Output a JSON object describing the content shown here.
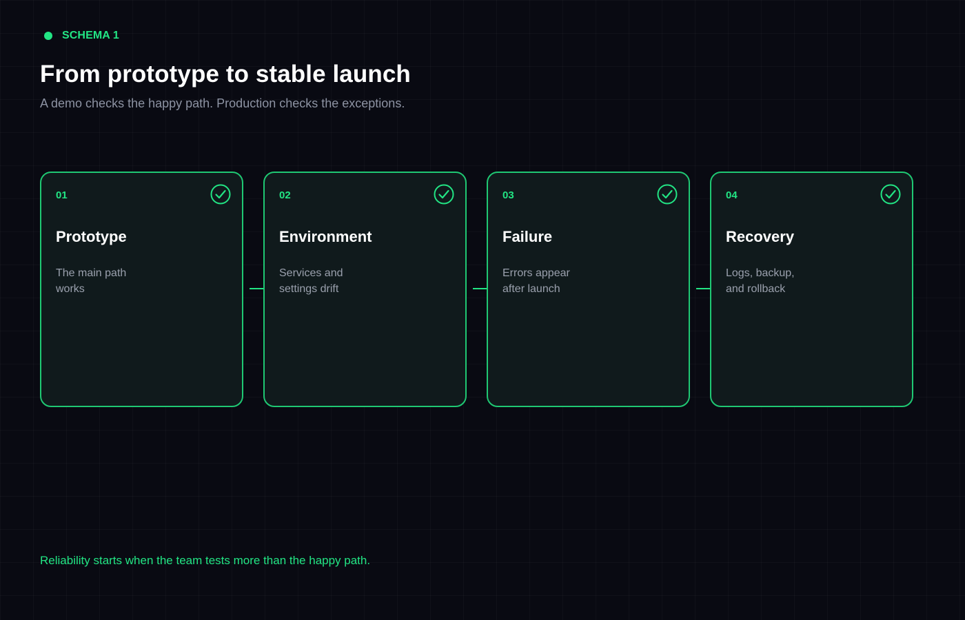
{
  "header": {
    "tag": "SCHEMA 1",
    "title": "From prototype to stable launch",
    "subtitle": "A demo checks the happy path. Production checks the exceptions."
  },
  "steps": [
    {
      "number": "01",
      "title": "Prototype",
      "description": "The main path\nworks",
      "icon": "check-circle-icon"
    },
    {
      "number": "02",
      "title": "Environment",
      "description": "Services and\nsettings drift",
      "icon": "check-circle-icon"
    },
    {
      "number": "03",
      "title": "Failure",
      "description": "Errors appear\nafter launch",
      "icon": "check-circle-icon"
    },
    {
      "number": "04",
      "title": "Recovery",
      "description": "Logs, backup,\nand rollback",
      "icon": "check-circle-icon"
    }
  ],
  "footer": {
    "note": "Reliability starts when the team tests more than the happy path."
  },
  "colors": {
    "accent": "#22e584",
    "background": "#090a12",
    "card_background": "#101a1c",
    "title": "#ffffff",
    "muted_text": "#8d93a3"
  }
}
